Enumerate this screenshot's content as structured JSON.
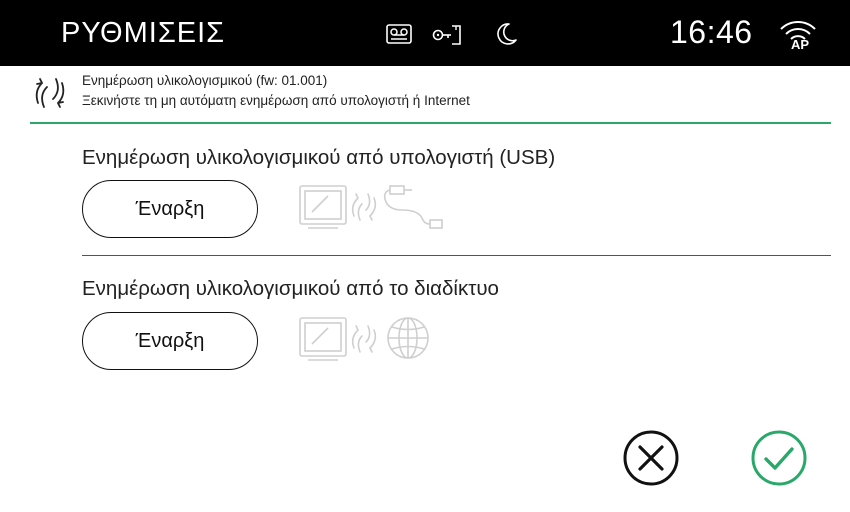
{
  "header": {
    "title": "ΡΥΘΜΙΣΕΙΣ",
    "time": "16:46",
    "icons": [
      "answering-machine-icon",
      "door-key-icon",
      "night-mode-moon-icon",
      "wifi-ap-icon"
    ],
    "wifi_label": "AP"
  },
  "info": {
    "icon": "firmware-update-icon",
    "line1": "Ενημέρωση υλικολογισμικού (fw: 01.001)",
    "line2": "Ξεκινήστε τη μη αυτόματη ενημέρωση από υπολογιστή ή Internet"
  },
  "usb_section": {
    "title": "Ενημέρωση υλικολογισμικού από υπολογιστή (USB)",
    "button_label": "Έναρξη",
    "illustration": [
      "monitor-icon",
      "sync-arrows-icon",
      "usb-cable-icon"
    ]
  },
  "internet_section": {
    "title": "Ενημέρωση υλικολογισμικού από το διαδίκτυο",
    "button_label": "Έναρξη",
    "illustration": [
      "monitor-icon",
      "sync-arrows-icon",
      "globe-icon"
    ]
  },
  "actions": {
    "cancel_icon": "cancel-x-circle-icon",
    "confirm_icon": "confirm-check-circle-icon",
    "confirm_color": "#2aa86a"
  },
  "colors": {
    "header_bg": "#000000",
    "accent": "#2aa86a",
    "illustration_gray": "#cfcfcf"
  }
}
